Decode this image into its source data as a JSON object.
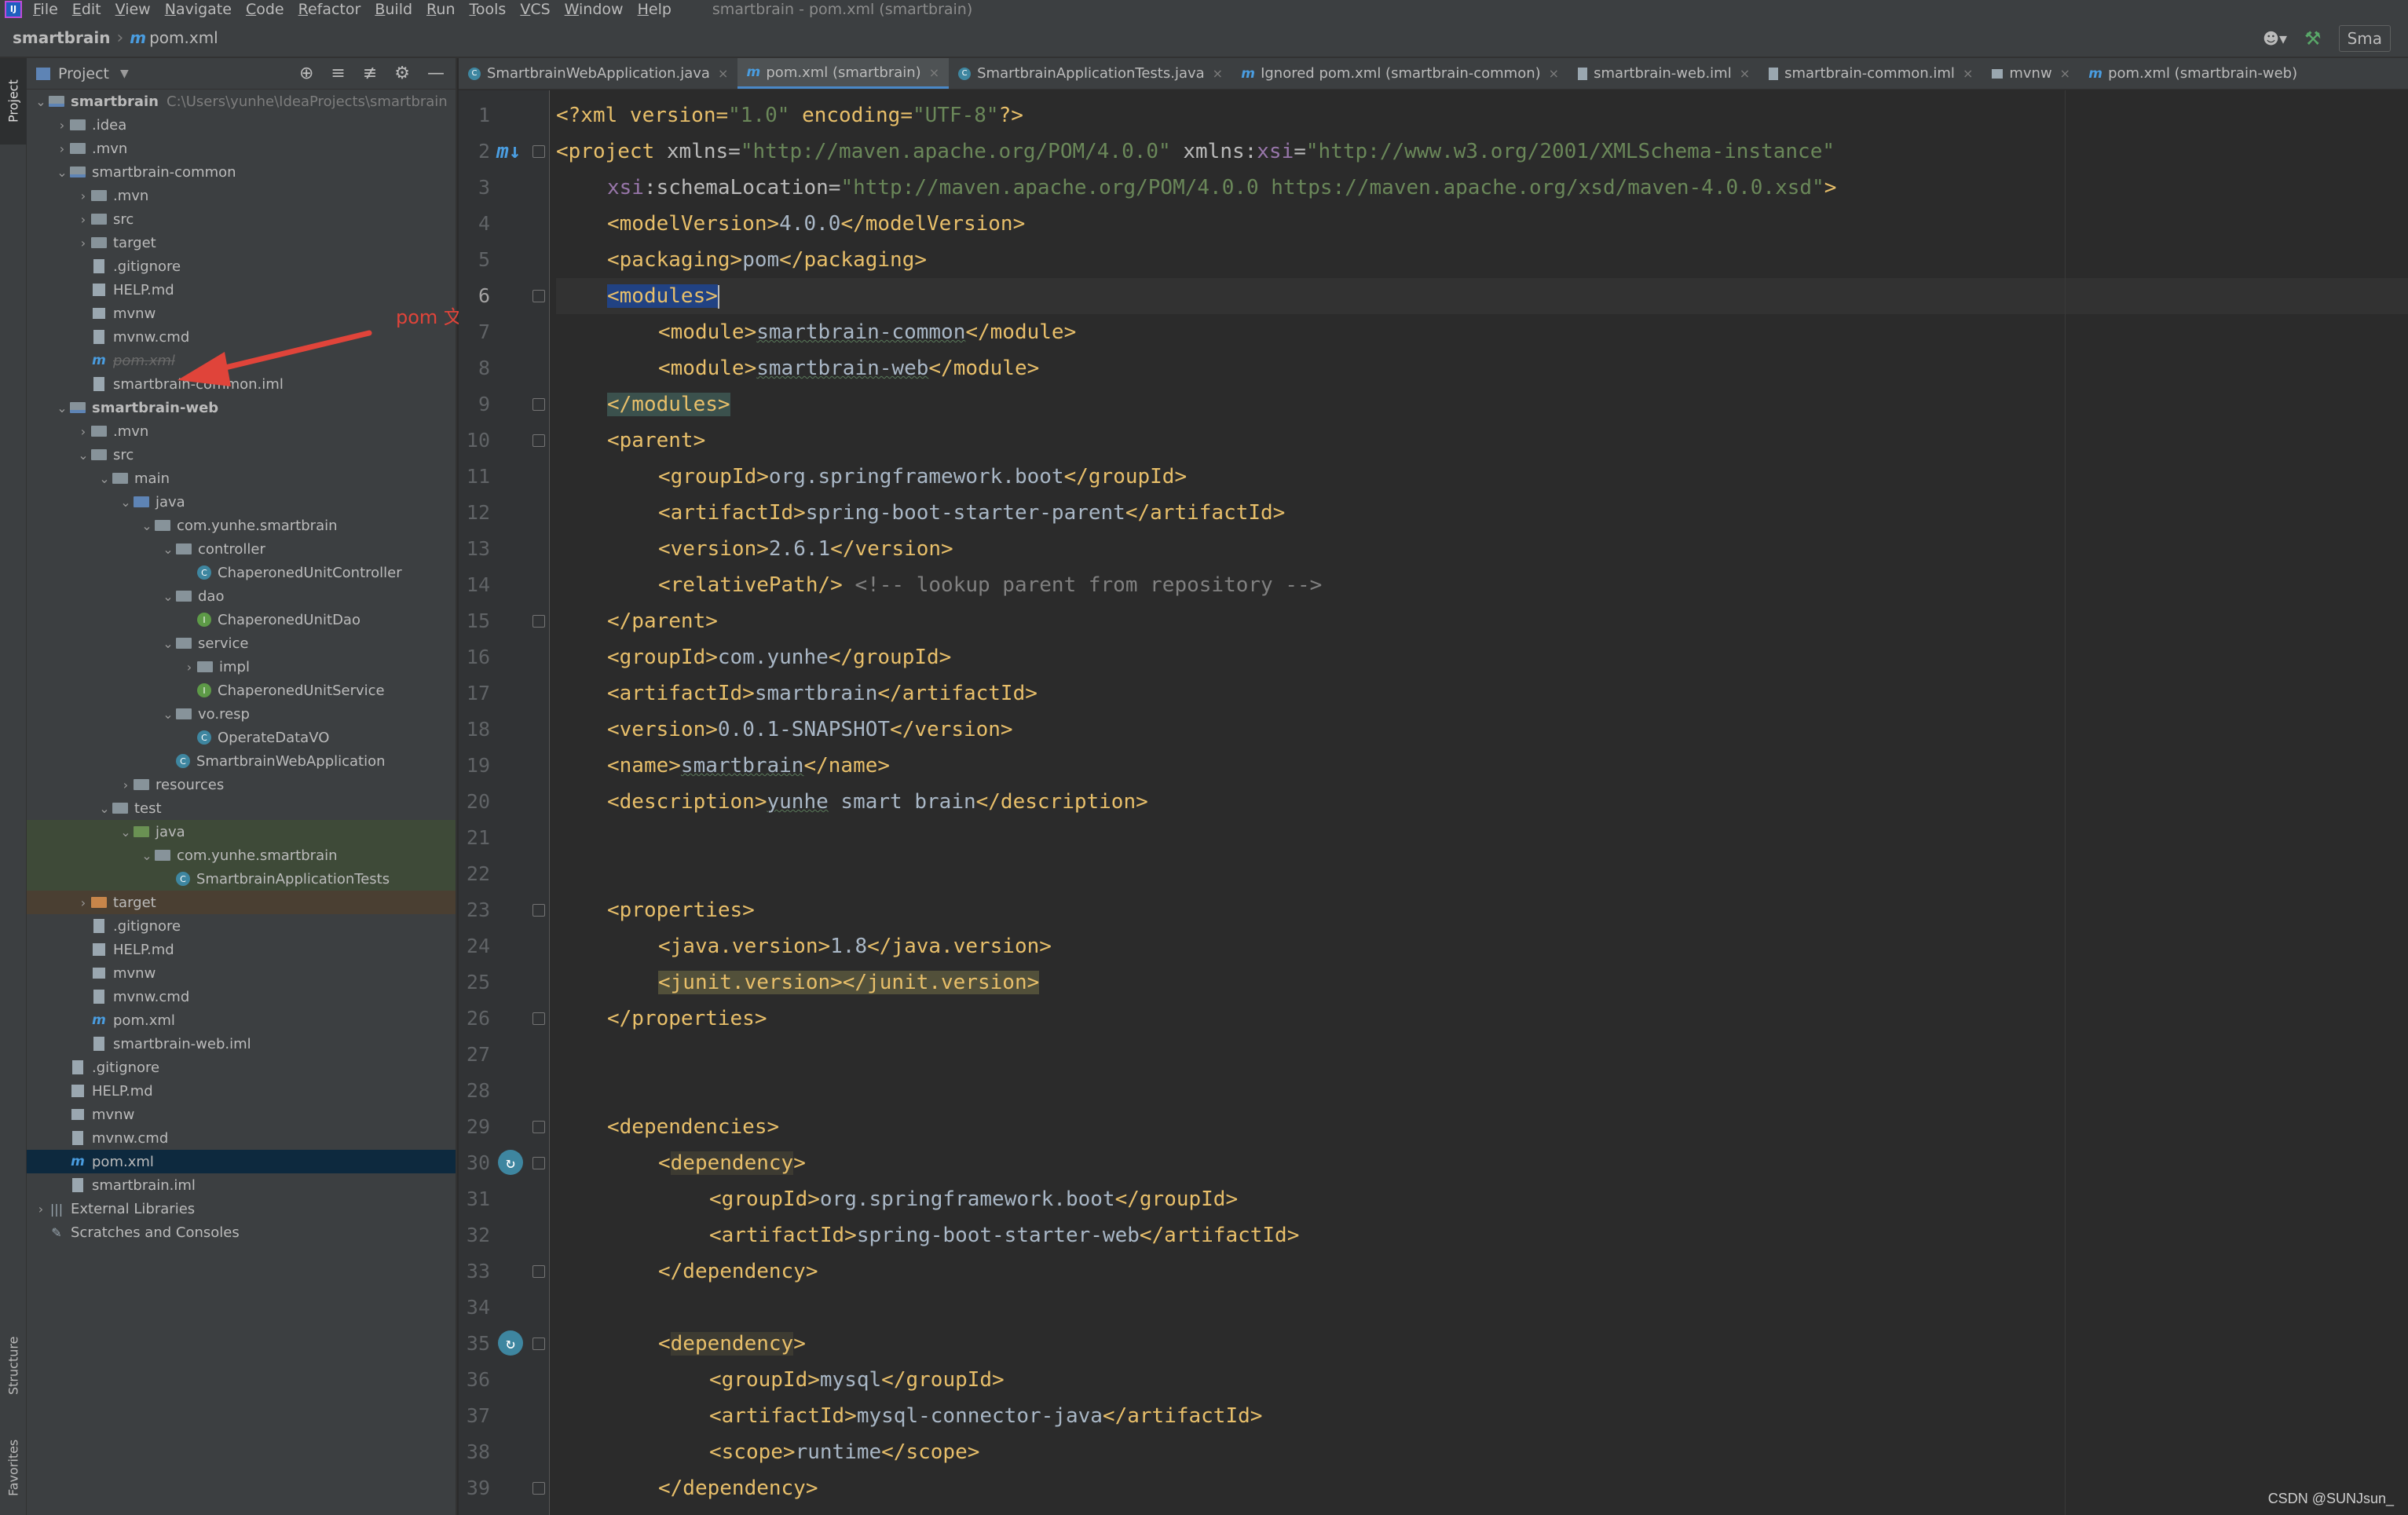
{
  "menubar": {
    "items": [
      "File",
      "Edit",
      "View",
      "Navigate",
      "Code",
      "Refactor",
      "Build",
      "Run",
      "Tools",
      "VCS",
      "Window",
      "Help"
    ],
    "window_title": "smartbrain - pom.xml (smartbrain)"
  },
  "navbar": {
    "project": "smartbrain",
    "file": "pom.xml",
    "run_config": "Sma"
  },
  "left_strip": {
    "project": "Project",
    "structure": "Structure",
    "favorites": "Favorites"
  },
  "project_panel": {
    "title": "Project"
  },
  "tree": [
    {
      "depth": 0,
      "arrow": "down",
      "icon": "module",
      "label": "smartbrain",
      "bold": true,
      "path": "C:\\Users\\yunhe\\IdeaProjects\\smartbrain"
    },
    {
      "depth": 1,
      "arrow": "right",
      "icon": "folder",
      "label": ".idea"
    },
    {
      "depth": 1,
      "arrow": "right",
      "icon": "folder",
      "label": ".mvn"
    },
    {
      "depth": 1,
      "arrow": "down",
      "icon": "module",
      "label": "smartbrain-common"
    },
    {
      "depth": 2,
      "arrow": "right",
      "icon": "folder",
      "label": ".mvn"
    },
    {
      "depth": 2,
      "arrow": "right",
      "icon": "folder",
      "label": "src"
    },
    {
      "depth": 2,
      "arrow": "right",
      "icon": "folder",
      "label": "target"
    },
    {
      "depth": 2,
      "arrow": "",
      "icon": "file",
      "label": ".gitignore"
    },
    {
      "depth": 2,
      "arrow": "",
      "icon": "md",
      "label": "HELP.md"
    },
    {
      "depth": 2,
      "arrow": "",
      "icon": "term",
      "label": "mvnw"
    },
    {
      "depth": 2,
      "arrow": "",
      "icon": "file",
      "label": "mvnw.cmd"
    },
    {
      "depth": 2,
      "arrow": "",
      "icon": "maven",
      "label": "pom.xml",
      "style": "strike"
    },
    {
      "depth": 2,
      "arrow": "",
      "icon": "file",
      "label": "smartbrain-common.iml"
    },
    {
      "depth": 1,
      "arrow": "down",
      "icon": "module",
      "label": "smartbrain-web",
      "bold": true
    },
    {
      "depth": 2,
      "arrow": "right",
      "icon": "folder",
      "label": ".mvn"
    },
    {
      "depth": 2,
      "arrow": "down",
      "icon": "folder",
      "label": "src"
    },
    {
      "depth": 3,
      "arrow": "down",
      "icon": "folder",
      "label": "main"
    },
    {
      "depth": 4,
      "arrow": "down",
      "icon": "folder-blue",
      "label": "java"
    },
    {
      "depth": 5,
      "arrow": "down",
      "icon": "folder",
      "label": "com.yunhe.smartbrain"
    },
    {
      "depth": 6,
      "arrow": "down",
      "icon": "folder",
      "label": "controller"
    },
    {
      "depth": 7,
      "arrow": "",
      "icon": "class",
      "label": "ChaperonedUnitController"
    },
    {
      "depth": 6,
      "arrow": "down",
      "icon": "folder",
      "label": "dao"
    },
    {
      "depth": 7,
      "arrow": "",
      "icon": "interface",
      "label": "ChaperonedUnitDao"
    },
    {
      "depth": 6,
      "arrow": "down",
      "icon": "folder",
      "label": "service"
    },
    {
      "depth": 7,
      "arrow": "right",
      "icon": "folder",
      "label": "impl"
    },
    {
      "depth": 7,
      "arrow": "",
      "icon": "interface",
      "label": "ChaperonedUnitService"
    },
    {
      "depth": 6,
      "arrow": "down",
      "icon": "folder",
      "label": "vo.resp"
    },
    {
      "depth": 7,
      "arrow": "",
      "icon": "class",
      "label": "OperateDataVO"
    },
    {
      "depth": 6,
      "arrow": "",
      "icon": "class",
      "label": "SmartbrainWebApplication"
    },
    {
      "depth": 4,
      "arrow": "right",
      "icon": "folder",
      "label": "resources"
    },
    {
      "depth": 3,
      "arrow": "down",
      "icon": "folder",
      "label": "test"
    },
    {
      "depth": 4,
      "arrow": "down",
      "icon": "folder-green",
      "label": "java",
      "bg": "green"
    },
    {
      "depth": 5,
      "arrow": "down",
      "icon": "folder",
      "label": "com.yunhe.smartbrain",
      "bg": "green"
    },
    {
      "depth": 6,
      "arrow": "",
      "icon": "class",
      "label": "SmartbrainApplicationTests",
      "bg": "green"
    },
    {
      "depth": 2,
      "arrow": "right",
      "icon": "folder-orange",
      "label": "target",
      "bg": "orange"
    },
    {
      "depth": 2,
      "arrow": "",
      "icon": "file",
      "label": ".gitignore"
    },
    {
      "depth": 2,
      "arrow": "",
      "icon": "md",
      "label": "HELP.md"
    },
    {
      "depth": 2,
      "arrow": "",
      "icon": "term",
      "label": "mvnw"
    },
    {
      "depth": 2,
      "arrow": "",
      "icon": "file",
      "label": "mvnw.cmd"
    },
    {
      "depth": 2,
      "arrow": "",
      "icon": "maven",
      "label": "pom.xml"
    },
    {
      "depth": 2,
      "arrow": "",
      "icon": "file",
      "label": "smartbrain-web.iml"
    },
    {
      "depth": 1,
      "arrow": "",
      "icon": "file",
      "label": ".gitignore"
    },
    {
      "depth": 1,
      "arrow": "",
      "icon": "md",
      "label": "HELP.md"
    },
    {
      "depth": 1,
      "arrow": "",
      "icon": "term",
      "label": "mvnw"
    },
    {
      "depth": 1,
      "arrow": "",
      "icon": "file",
      "label": "mvnw.cmd"
    },
    {
      "depth": 1,
      "arrow": "",
      "icon": "maven",
      "label": "pom.xml",
      "selected": true
    },
    {
      "depth": 1,
      "arrow": "",
      "icon": "file",
      "label": "smartbrain.iml"
    },
    {
      "depth": 0,
      "arrow": "right",
      "icon": "lib",
      "label": "External Libraries"
    },
    {
      "depth": 0,
      "arrow": "",
      "icon": "scratch",
      "label": "Scratches and Consoles"
    }
  ],
  "annotation": {
    "text": "pom 文件置灰",
    "color": "#e0443a"
  },
  "tabs": [
    {
      "icon": "class",
      "label": "SmartbrainWebApplication.java"
    },
    {
      "icon": "maven",
      "label": "pom.xml (smartbrain)",
      "active": true
    },
    {
      "icon": "class",
      "label": "SmartbrainApplicationTests.java"
    },
    {
      "icon": "maven",
      "label": "Ignored pom.xml (smartbrain-common)"
    },
    {
      "icon": "file",
      "label": "smartbrain-web.iml"
    },
    {
      "icon": "file",
      "label": "smartbrain-common.iml"
    },
    {
      "icon": "term",
      "label": "mvnw"
    },
    {
      "icon": "maven",
      "label": "pom.xml (smartbrain-web)",
      "noclose": true
    }
  ],
  "editor": {
    "current_line": 6,
    "lines": [
      "1",
      "2",
      "3",
      "4",
      "5",
      "6",
      "7",
      "8",
      "9",
      "10",
      "11",
      "12",
      "13",
      "14",
      "15",
      "16",
      "17",
      "18",
      "19",
      "20",
      "21",
      "22",
      "23",
      "24",
      "25",
      "26",
      "27",
      "28",
      "29",
      "30",
      "31",
      "32",
      "33",
      "34",
      "35",
      "36",
      "37",
      "38",
      "39"
    ],
    "code": {
      "xml_decl": [
        "<?xml version=",
        "\"1.0\"",
        " encoding=",
        "\"UTF-8\"",
        "?>"
      ],
      "l2": [
        "<project ",
        "xmlns",
        "=",
        "\"http://maven.apache.org/POM/4.0.0\"",
        " xmlns:",
        "xsi",
        "=",
        "\"http://www.w3.org/2001/XMLSchema-instance\""
      ],
      "l3": [
        "xsi",
        ":schemaLocation",
        "=",
        "\"http://maven.apache.org/POM/4.0.0 https://maven.apache.org/xsd/maven-4.0.0.xsd\"",
        ">"
      ],
      "l4": [
        "<modelVersion>",
        "4.0.0",
        "</modelVersion>"
      ],
      "l5": [
        "<packaging>",
        "pom",
        "</packaging>"
      ],
      "l6": [
        "<modules>"
      ],
      "l7": [
        "<module>",
        "smartbrain-common",
        "</module>"
      ],
      "l8": [
        "<module>",
        "smartbrain-web",
        "</module>"
      ],
      "l9": [
        "</modules>"
      ],
      "l10": [
        "<parent>"
      ],
      "l11": [
        "<groupId>",
        "org.springframework.boot",
        "</groupId>"
      ],
      "l12": [
        "<artifactId>",
        "spring-boot-starter-parent",
        "</artifactId>"
      ],
      "l13": [
        "<version>",
        "2.6.1",
        "</version>"
      ],
      "l14": [
        "<relativePath/>",
        " <!-- lookup parent from repository -->"
      ],
      "l15": [
        "</parent>"
      ],
      "l16": [
        "<groupId>",
        "com.yunhe",
        "</groupId>"
      ],
      "l17": [
        "<artifactId>",
        "smartbrain",
        "</artifactId>"
      ],
      "l18": [
        "<version>",
        "0.0.1-SNAPSHOT",
        "</version>"
      ],
      "l19": [
        "<name>",
        "smartbrain",
        "</name>"
      ],
      "l20": [
        "<description>",
        "yunhe",
        " smart brain",
        "</description>"
      ],
      "l23": [
        "<properties>"
      ],
      "l24": [
        "<java.version>",
        "1.8",
        "</java.version>"
      ],
      "l25": [
        "<junit.version></junit.version>"
      ],
      "l26": [
        "</properties>"
      ],
      "l29": [
        "<dependencies>"
      ],
      "l30": [
        "<",
        "dependency",
        ">"
      ],
      "l31": [
        "<groupId>",
        "org.springframework.boot",
        "</groupId>"
      ],
      "l32": [
        "<artifactId>",
        "spring-boot-starter-web",
        "</artifactId>"
      ],
      "l33": [
        "</dependency>"
      ],
      "l35": [
        "<",
        "dependency",
        ">"
      ],
      "l36": [
        "<groupId>",
        "mysql",
        "</groupId>"
      ],
      "l37": [
        "<artifactId>",
        "mysql-connector-java",
        "</artifactId>"
      ],
      "l38": [
        "<scope>",
        "runtime",
        "</scope>"
      ],
      "l39": [
        "</dependency>"
      ]
    }
  },
  "watermark": "CSDN @SUNJsun_"
}
